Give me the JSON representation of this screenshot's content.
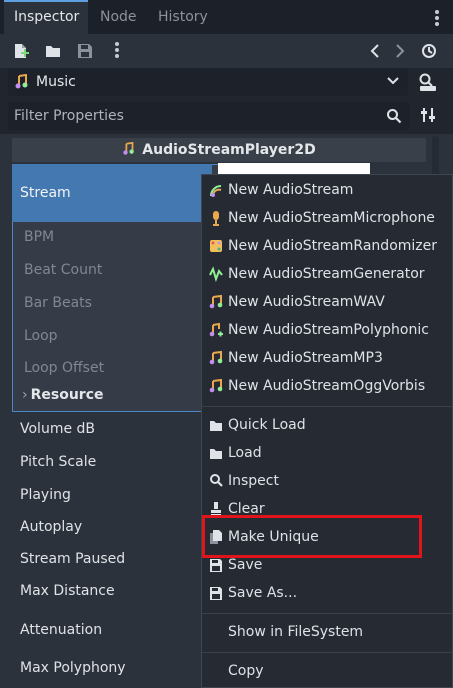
{
  "tabs": [
    {
      "label": "Inspector",
      "active": true
    },
    {
      "label": "Node",
      "active": false
    },
    {
      "label": "History",
      "active": false
    }
  ],
  "object_selector": {
    "name": "Music"
  },
  "filter": {
    "placeholder": "Filter Properties"
  },
  "class_header": {
    "title": "AudioStreamPlayer2D"
  },
  "stream": {
    "label": "Stream",
    "sub_properties": [
      "BPM",
      "Beat Count",
      "Bar Beats",
      "Loop",
      "Loop Offset"
    ],
    "resource_label": "Resource"
  },
  "properties": [
    "Volume dB",
    "Pitch Scale",
    "Playing",
    "Autoplay",
    "Stream Paused",
    "Max Distance",
    "Attenuation",
    "Max Polyphony"
  ],
  "context_menu": {
    "new_items": [
      {
        "label": "New AudioStream",
        "icon": "audiostream-icon"
      },
      {
        "label": "New AudioStreamMicrophone",
        "icon": "microphone-icon"
      },
      {
        "label": "New AudioStreamRandomizer",
        "icon": "randomizer-icon"
      },
      {
        "label": "New AudioStreamGenerator",
        "icon": "generator-icon"
      },
      {
        "label": "New AudioStreamWAV",
        "icon": "audio-note-icon"
      },
      {
        "label": "New AudioStreamPolyphonic",
        "icon": "audio-polyphonic-icon"
      },
      {
        "label": "New AudioStreamMP3",
        "icon": "audio-note-icon"
      },
      {
        "label": "New AudioStreamOggVorbis",
        "icon": "audio-note-icon"
      }
    ],
    "resource_items": [
      {
        "label": "Quick Load",
        "icon": "folder-icon"
      },
      {
        "label": "Load",
        "icon": "folder-icon"
      },
      {
        "label": "Inspect",
        "icon": "search-icon"
      },
      {
        "label": "Clear",
        "icon": "clear-icon"
      },
      {
        "label": "Make Unique",
        "icon": "duplicate-icon"
      },
      {
        "label": "Save",
        "icon": "save-icon"
      },
      {
        "label": "Save As...",
        "icon": "save-icon"
      }
    ],
    "show_in_filesystem": "Show in FileSystem",
    "copy": "Copy"
  },
  "colors": {
    "accent": "#4478b0",
    "highlight": "#e0151b",
    "tab_active": "#5e9fe0"
  }
}
